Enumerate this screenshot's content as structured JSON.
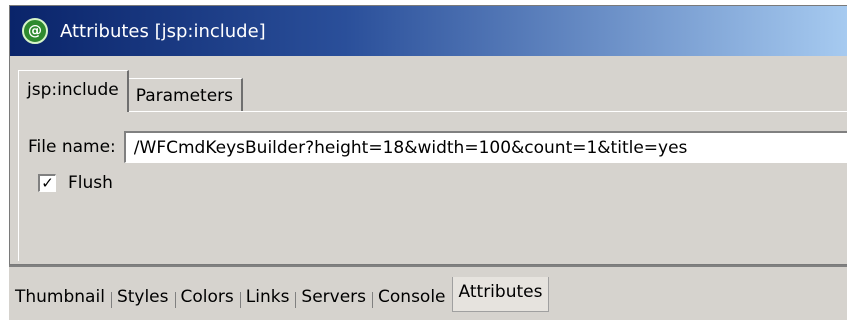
{
  "window": {
    "title": "Attributes [jsp:include]",
    "icon": "@"
  },
  "tabs": [
    {
      "label": "jsp:include",
      "active": true
    },
    {
      "label": "Parameters",
      "active": false
    }
  ],
  "file_field": {
    "label": "File name:",
    "value": "/WFCmdKeysBuilder?height=18&width=100&count=1&title=yes"
  },
  "flush": {
    "label": "Flush",
    "checked": true,
    "mark": "✓"
  },
  "bottom_tabs": [
    {
      "label": "Thumbnail",
      "active": false
    },
    {
      "label": "Styles",
      "active": false
    },
    {
      "label": "Colors",
      "active": false
    },
    {
      "label": "Links",
      "active": false
    },
    {
      "label": "Servers",
      "active": false
    },
    {
      "label": "Console",
      "active": false
    },
    {
      "label": "Attributes",
      "active": true
    }
  ],
  "colors": {
    "title_start": "#0a246a",
    "title_end": "#a6caf0",
    "panel": "#d6d3ce"
  }
}
